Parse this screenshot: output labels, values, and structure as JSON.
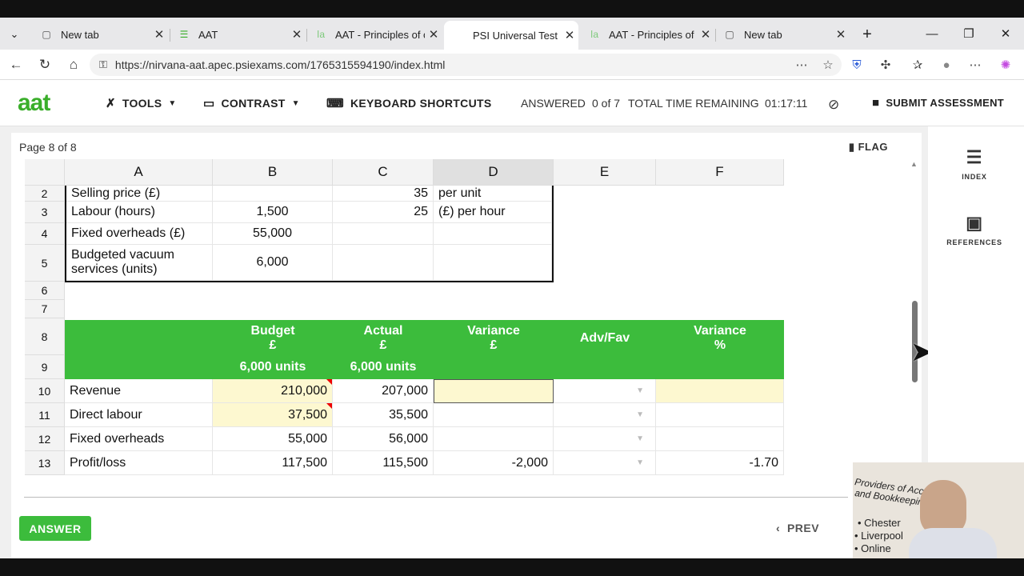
{
  "browser": {
    "tabs": [
      {
        "label": "New tab",
        "icon": "page-icon"
      },
      {
        "label": "AAT",
        "icon": "aat-icon"
      },
      {
        "label": "AAT - Principles of co",
        "icon": "aat-icon"
      },
      {
        "label": "PSI Universal Test Dri",
        "icon": "psi-icon"
      },
      {
        "label": "AAT - Principles of co",
        "icon": "aat-icon"
      },
      {
        "label": "New tab",
        "icon": "page-icon"
      }
    ],
    "url": "https://nirvana-aat.apec.psiexams.com/1765315594190/index.html"
  },
  "app": {
    "logo": "aat",
    "tools": "TOOLS",
    "contrast": "CONTRAST",
    "shortcuts": "KEYBOARD SHORTCUTS",
    "answered_label": "ANSWERED",
    "answered_value": "0 of 7",
    "time_label": "TOTAL TIME REMAINING",
    "time_value": "01:17:11",
    "submit": "SUBMIT ASSESSMENT"
  },
  "page": {
    "label": "Page 8 of 8",
    "flag": "FLAG",
    "answer": "ANSWER",
    "prev": "PREV"
  },
  "sidebar": {
    "index": "INDEX",
    "references": "REFERENCES"
  },
  "sheet": {
    "columns": [
      "A",
      "B",
      "C",
      "D",
      "E",
      "F"
    ],
    "rows": {
      "r2": {
        "num": "2",
        "a": "Selling price (£)",
        "c": "35",
        "d": "per unit"
      },
      "r3": {
        "num": "3",
        "a": "Labour (hours)",
        "b": "1,500",
        "c": "25",
        "d": "(£) per hour"
      },
      "r4": {
        "num": "4",
        "a": "Fixed overheads (£)",
        "b": "55,000"
      },
      "r5": {
        "num": "5",
        "a": "Budgeted vacuum services (units)",
        "b": "6,000"
      },
      "r6": {
        "num": "6"
      },
      "r7": {
        "num": "7"
      },
      "r8": {
        "num": "8",
        "b": "Budget\n£",
        "c": "Actual\n£",
        "d": "Variance\n£",
        "e": "Adv/Fav",
        "f": "Variance\n%"
      },
      "r9": {
        "num": "9",
        "b": "6,000 units",
        "c": "6,000 units"
      },
      "r10": {
        "num": "10",
        "a": "Revenue",
        "b": "210,000",
        "c": "207,000"
      },
      "r11": {
        "num": "11",
        "a": "Direct labour",
        "b": "37,500",
        "c": "35,500"
      },
      "r12": {
        "num": "12",
        "a": "Fixed overheads",
        "b": "55,000",
        "c": "56,000"
      },
      "r13": {
        "num": "13",
        "a": "Profit/loss",
        "b": "117,500",
        "c": "115,500",
        "d": "-2,000",
        "f": "-1.70"
      }
    }
  },
  "webcam": {
    "sign_line1": "Providers of Accou",
    "sign_line2": "and Bookkeeping c",
    "bullets": [
      "Chester",
      "Liverpool",
      "Online"
    ]
  },
  "colors": {
    "accent": "#3cbc3c",
    "input": "#fdf8d0",
    "logo": "#3aae2a"
  }
}
